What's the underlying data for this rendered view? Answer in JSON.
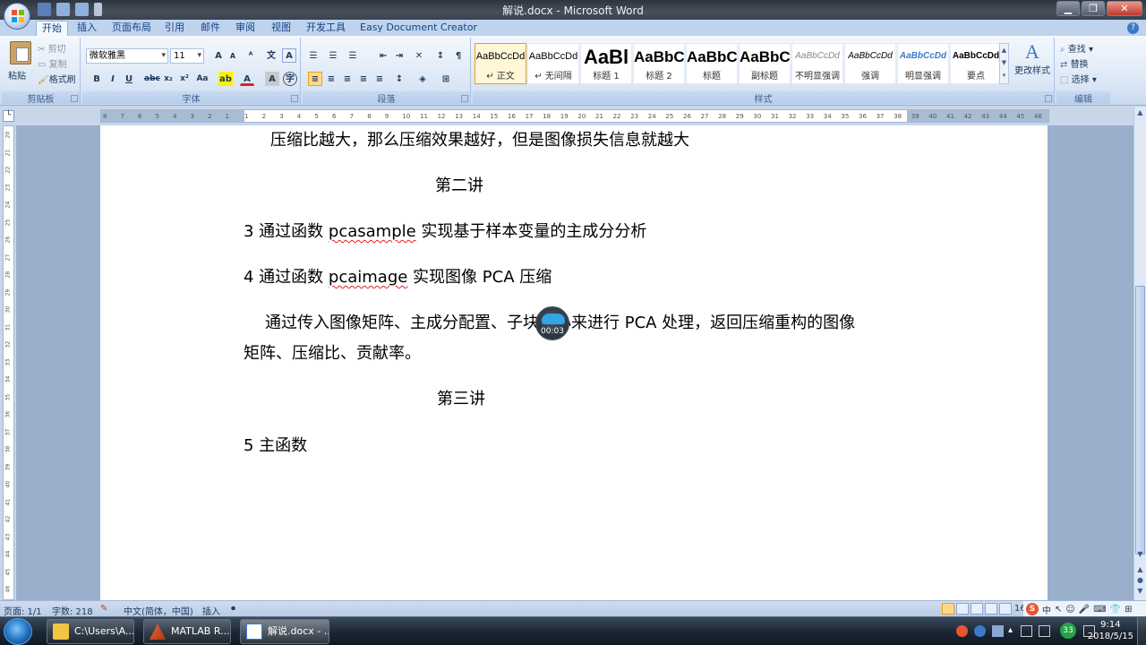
{
  "window": {
    "title": "解说.docx - Microsoft Word",
    "controls": [
      "▁",
      "❐",
      "✕"
    ]
  },
  "tabs": [
    "开始",
    "插入",
    "页面布局",
    "引用",
    "邮件",
    "审阅",
    "视图",
    "开发工具",
    "Easy Document Creator"
  ],
  "clipboard": {
    "paste": "粘贴",
    "cut": "剪切",
    "copy": "复制",
    "format_painter": "格式刷",
    "label": "剪贴板"
  },
  "font": {
    "name": "微软雅黑",
    "size": "11",
    "label": "字体"
  },
  "paragraph": {
    "label": "段落"
  },
  "styles": {
    "label": "样式",
    "items": [
      {
        "preview": "AaBbCcDd",
        "name": "↵ 正文"
      },
      {
        "preview": "AaBbCcDd",
        "name": "↵ 无间隔"
      },
      {
        "preview": "AaBl",
        "name": "标题 1"
      },
      {
        "preview": "AaBbC",
        "name": "标题 2"
      },
      {
        "preview": "AaBbC",
        "name": "标题"
      },
      {
        "preview": "AaBbC",
        "name": "副标题"
      },
      {
        "preview": "AaBbCcDd",
        "name": "不明显强调"
      },
      {
        "preview": "AaBbCcDd",
        "name": "强调"
      },
      {
        "preview": "AaBbCcDd",
        "name": "明显强调"
      },
      {
        "preview": "AaBbCcDd",
        "name": "要点"
      }
    ],
    "change_styles": "更改样式"
  },
  "editing": {
    "find": "查找",
    "replace": "替换",
    "select": "选择",
    "label": "编辑"
  },
  "document": {
    "line1": "压缩比越大，那么压缩效果越好，但是图像损失信息就越大",
    "heading2": "第二讲",
    "item3_prefix": "3 通过函数 ",
    "item3_fn": "pcasample",
    "item3_suffix": " 实现基于样本变量的主成分分析",
    "item4_prefix": "4 通过函数 ",
    "item4_fn": "pcaimage",
    "item4_suffix": " 实现图像 PCA 压缩",
    "desc_line1": "通过传入图像矩阵、主成分配置、子块大小来进行 PCA 处理，返回压缩重构的图像",
    "desc_line2": "矩阵、压缩比、贡献率。",
    "heading3": "第三讲",
    "item5": "5 主函数"
  },
  "recording_timer": "00:03",
  "status": {
    "page": "页面: 1/1",
    "words": "字数: 218",
    "language": "中文(简体，中国)",
    "mode": "插入",
    "zoom_partial": "16"
  },
  "ime": {
    "lang": "中"
  },
  "taskbar": {
    "items": [
      {
        "label": "C:\\Users\\A..."
      },
      {
        "label": "MATLAB R..."
      },
      {
        "label": "解说.docx - ..."
      }
    ],
    "tray_badge": "33",
    "time": "9:14",
    "date": "2018/5/15"
  }
}
